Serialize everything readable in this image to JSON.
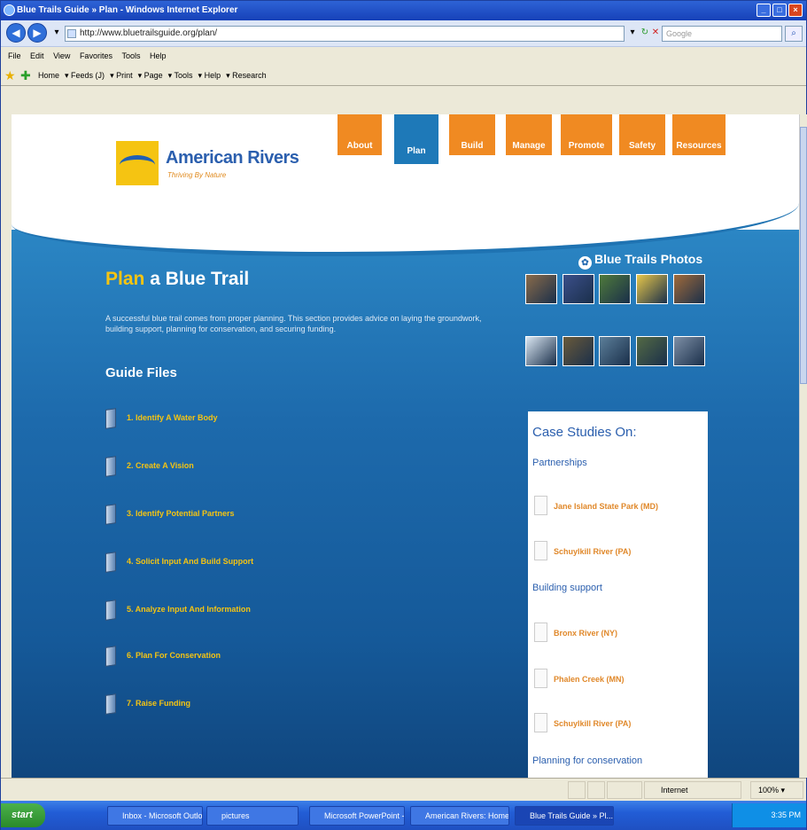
{
  "window": {
    "title": "Blue Trails Guide » Plan - Windows Internet Explorer"
  },
  "address_bar": {
    "url": "http://www.bluetrailsguide.org/plan/",
    "search_placeholder": "Google"
  },
  "menu": [
    "File",
    "Edit",
    "View",
    "Favorites",
    "Tools",
    "Help"
  ],
  "command_bar": [
    "Home",
    "Feeds (J)",
    "Print",
    "Page",
    "Tools",
    "Help",
    "Research"
  ],
  "site": {
    "logo_name": "American Rivers",
    "tagline": "Thriving By Nature",
    "nav": [
      {
        "label": "About",
        "active": false
      },
      {
        "label": "Plan",
        "active": true
      },
      {
        "label": "Build",
        "active": false
      },
      {
        "label": "Manage",
        "active": false
      },
      {
        "label": "Promote",
        "active": false
      },
      {
        "label": "Safety",
        "active": false
      },
      {
        "label": "Resources",
        "active": false
      }
    ],
    "heading_highlight": "Plan",
    "heading_rest": "a Blue Trail",
    "intro": "A successful blue trail comes from proper planning. This section provides advice on laying the groundwork, building support, planning for conservation, and securing funding.",
    "guide_title": "Guide Files",
    "guide_files": [
      "1. Identify A Water Body",
      "2. Create A Vision",
      "3. Identify Potential Partners",
      "4. Solicit Input And Build Support",
      "5. Analyze Input And Information",
      "6. Plan For Conservation",
      "7. Raise Funding"
    ],
    "photos_title": "Blue Trails Photos",
    "photo_colors": [
      "#8a6b4a",
      "#3b4f8a",
      "#4f7a3a",
      "#e7c74a",
      "#a06a3a",
      "#d9e6f2",
      "#6a5a3a",
      "#5c7f9a",
      "#546a44",
      "#7d8fa6"
    ],
    "cases": {
      "title": "Case Studies On:",
      "groups": [
        {
          "name": "Partnerships",
          "items": [
            "Jane Island State Park (MD)",
            "Schuylkill River (PA)"
          ]
        },
        {
          "name": "Building support",
          "items": [
            "Bronx River (NY)",
            "Phalen Creek (MN)",
            "Schuylkill River (PA)"
          ]
        },
        {
          "name": "Planning for conservation",
          "items": []
        }
      ]
    }
  },
  "status": {
    "zone": "Internet",
    "zoom": "100%"
  },
  "taskbar": {
    "start": "start",
    "tasks": [
      "Inbox - Microsoft Outlook",
      "pictures",
      "Microsoft PowerPoint - [...",
      "American Rivers: Home -...",
      "Blue Trails Guide » Pl..."
    ],
    "clock": "3:35 PM"
  },
  "colors": {
    "accent_orange": "#f08a22",
    "brand_blue": "#1e79b8",
    "highlight_yellow": "#f5c412"
  }
}
